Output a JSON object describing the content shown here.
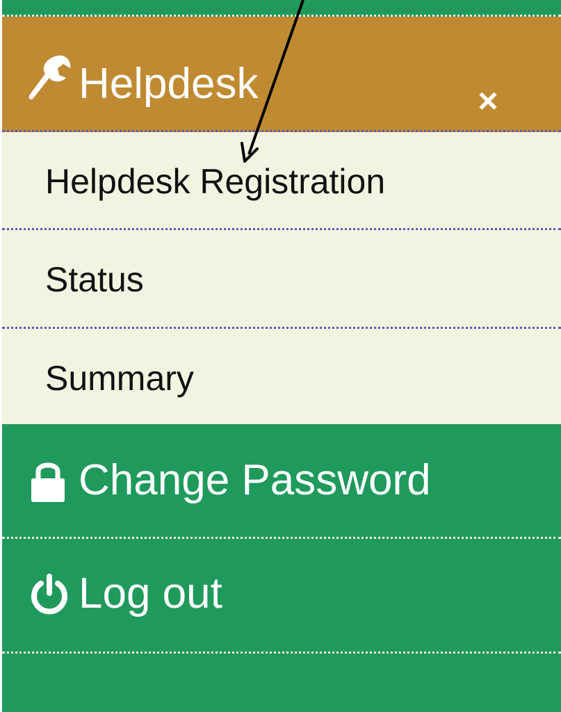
{
  "menu": {
    "section": {
      "label": "Helpdesk",
      "icon": "wrench-icon",
      "close_symbol": "×",
      "header_color": "#bf8a31"
    },
    "sub_items": [
      {
        "label": "Helpdesk Registration"
      },
      {
        "label": "Status"
      },
      {
        "label": "Summary"
      }
    ],
    "main_items": [
      {
        "label": "Change Password",
        "icon": "lock-icon"
      },
      {
        "label": "Log out",
        "icon": "power-icon"
      }
    ],
    "colors": {
      "menu_green": "#1f9a5c",
      "submenu_cream": "#f3f3e2",
      "separator_blue": "#5a5ab8"
    }
  }
}
